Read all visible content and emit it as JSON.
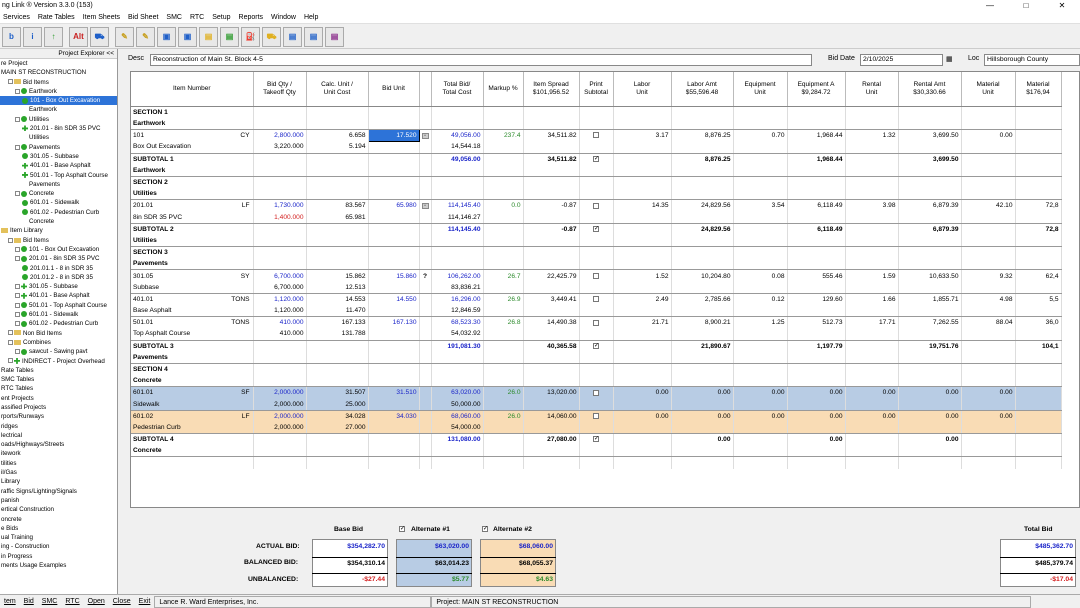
{
  "window": {
    "title": "ng Link ® Version  3.3.0 (153)",
    "controls": [
      "—",
      "□",
      "✕"
    ]
  },
  "menu": [
    "Services",
    "Rate Tables",
    "Item Sheets",
    "Bid Sheet",
    "SMC",
    "RTC",
    "Setup",
    "Reports",
    "Window",
    "Help"
  ],
  "toolbar": [
    "b",
    "i",
    "↑",
    "Alt",
    "⛟",
    "✎",
    "✎",
    "▣",
    "▣",
    "▤",
    "▤",
    "⛽",
    "⛟",
    "▤",
    "▤",
    "▤"
  ],
  "explorer": {
    "title": "Project Explorer <<",
    "tree": [
      {
        "t": "re Project",
        "d": 0,
        "i": ""
      },
      {
        "t": "MAIN ST RECONSTRUCTION",
        "d": 0,
        "i": ""
      },
      {
        "t": "Bid Items",
        "d": 1,
        "i": "f"
      },
      {
        "t": "Earthwork",
        "d": 2,
        "i": "g"
      },
      {
        "t": "101 - Box Out Excavation",
        "d": 3,
        "i": "g",
        "sel": true
      },
      {
        "t": "Earthwork",
        "d": 4,
        "i": ""
      },
      {
        "t": "Utilities",
        "d": 2,
        "i": "g"
      },
      {
        "t": "201.01 - 8in SDR 35 PVC",
        "d": 3,
        "i": "p"
      },
      {
        "t": "Utilities",
        "d": 4,
        "i": ""
      },
      {
        "t": "Pavements",
        "d": 2,
        "i": "g"
      },
      {
        "t": "301.05 - Subbase",
        "d": 3,
        "i": "g"
      },
      {
        "t": "401.01 - Base Asphalt",
        "d": 3,
        "i": "p"
      },
      {
        "t": "501.01 - Top Asphalt Course",
        "d": 3,
        "i": "p"
      },
      {
        "t": "Pavements",
        "d": 4,
        "i": ""
      },
      {
        "t": "Concrete",
        "d": 2,
        "i": "g"
      },
      {
        "t": "601.01 - Sidewalk",
        "d": 3,
        "i": "g"
      },
      {
        "t": "601.02 - Pedestrian Curb",
        "d": 3,
        "i": "g"
      },
      {
        "t": "Concrete",
        "d": 4,
        "i": ""
      },
      {
        "t": "Item Library",
        "d": 0,
        "i": "f"
      },
      {
        "t": "Bid Items",
        "d": 1,
        "i": "f"
      },
      {
        "t": "101 - Box Out Excavation",
        "d": 2,
        "i": "g"
      },
      {
        "t": "201.01 - 8in SDR 35 PVC",
        "d": 2,
        "i": "g"
      },
      {
        "t": "201.01.1 - 8 in SDR 35",
        "d": 3,
        "i": "g"
      },
      {
        "t": "201.01.2 - 8 in SDR 35",
        "d": 3,
        "i": "g"
      },
      {
        "t": "301.05 - Subbase",
        "d": 2,
        "i": "p"
      },
      {
        "t": "401.01 - Base Asphalt",
        "d": 2,
        "i": "p"
      },
      {
        "t": "501.01 - Top Asphalt Course",
        "d": 2,
        "i": "g"
      },
      {
        "t": "601.01 - Sidewalk",
        "d": 2,
        "i": "g"
      },
      {
        "t": "601.02 - Pedestrian Curb",
        "d": 2,
        "i": "g"
      },
      {
        "t": "Non Bid Items",
        "d": 1,
        "i": "f"
      },
      {
        "t": "Combines",
        "d": 1,
        "i": "f"
      },
      {
        "t": "sawcut - Sawing pavt",
        "d": 2,
        "i": "g"
      },
      {
        "t": "INDIRECT - Project Overhead",
        "d": 1,
        "i": "p"
      },
      {
        "t": "Rate Tables",
        "d": 0,
        "i": ""
      },
      {
        "t": "SMC Tables",
        "d": 0,
        "i": ""
      },
      {
        "t": "RTC Tables",
        "d": 0,
        "i": ""
      },
      {
        "t": "ent Projects",
        "d": 0,
        "i": ""
      },
      {
        "t": "assified Projects",
        "d": 0,
        "i": ""
      },
      {
        "t": "rports/Runways",
        "d": 0,
        "i": ""
      },
      {
        "t": "ridges",
        "d": 0,
        "i": ""
      },
      {
        "t": "lectrical",
        "d": 0,
        "i": ""
      },
      {
        "t": "oads/Highways/Streets",
        "d": 0,
        "i": ""
      },
      {
        "t": "itework",
        "d": 0,
        "i": ""
      },
      {
        "t": "tilities",
        "d": 0,
        "i": ""
      },
      {
        "t": "il/Gas",
        "d": 0,
        "i": ""
      },
      {
        "t": "Library",
        "d": 0,
        "i": ""
      },
      {
        "t": "raffic Signs/Lighting/Signals",
        "d": 0,
        "i": ""
      },
      {
        "t": "panish",
        "d": 0,
        "i": ""
      },
      {
        "t": "ertical Construction",
        "d": 0,
        "i": ""
      },
      {
        "t": "oncrete",
        "d": 0,
        "i": ""
      },
      {
        "t": "e Bids",
        "d": 0,
        "i": ""
      },
      {
        "t": "ual Training",
        "d": 0,
        "i": ""
      },
      {
        "t": "ing - Construction",
        "d": 0,
        "i": ""
      },
      {
        "t": "in Progress",
        "d": 0,
        "i": ""
      },
      {
        "t": "ments Usage Examples",
        "d": 0,
        "i": ""
      }
    ]
  },
  "header": {
    "desc_label": "Desc",
    "desc": "Reconstruction of Main St. Block 4-5",
    "date_label": "Bid Date",
    "date": "2/10/2025",
    "loc_label": "Loc",
    "loc": "Hillsborough County"
  },
  "columns": [
    {
      "l": "Item Number",
      "w": 122
    },
    {
      "l": "Bid Qty /\nTakeoff Qty",
      "w": 53
    },
    {
      "l": "Calc. Unit /\nUnit Cost",
      "w": 62
    },
    {
      "l": "Bid Unit",
      "w": 51
    },
    {
      "l": "",
      "w": 12
    },
    {
      "l": "Total Bid/\nTotal Cost",
      "w": 52
    },
    {
      "l": "Markup %",
      "w": 40
    },
    {
      "l": "Item Spread\n$101,956.52",
      "w": 56
    },
    {
      "l": "Print\nSubtotal",
      "w": 34
    },
    {
      "l": "Labor\nUnit",
      "w": 58
    },
    {
      "l": "Labor Amt\n$55,596.48",
      "w": 62
    },
    {
      "l": "Equipment\nUnit",
      "w": 54
    },
    {
      "l": "Equipment A\n$9,284.72",
      "w": 58
    },
    {
      "l": "Rental\nUnit",
      "w": 53
    },
    {
      "l": "Rental Amt\n$30,330.66",
      "w": 63
    },
    {
      "l": "Material\nUnit",
      "w": 54
    },
    {
      "l": "Material\n$176,94",
      "w": 46
    }
  ],
  "rows": [
    {
      "k": "sec",
      "a": "SECTION 1"
    },
    {
      "k": "sec2",
      "a": "Earthwork"
    },
    {
      "k": "i1",
      "cls": "",
      "arrow": true,
      "a": "101",
      "u": "CY",
      "q": "2,800.000",
      "cu": "6.658",
      "bu": "17.520",
      "tb": "49,056.00",
      "mk": "237.4",
      "sp": "34,511.82",
      "ps": false,
      "lu": "3.17",
      "la": "8,876.25",
      "eu": "0.70",
      "ea": "1,968.44",
      "ru": "1.32",
      "ra": "3,699.50",
      "mu": "0.00",
      "ma": ""
    },
    {
      "k": "i2",
      "cls": "",
      "a": "Box Out Excavation",
      "q": "3,220.000",
      "cu": "5.194",
      "tb": "14,544.18"
    },
    {
      "k": "sub",
      "a": "SUBTOTAL 1",
      "tb": "49,056.00",
      "sp": "34,511.82",
      "ps": true,
      "la": "8,876.25",
      "ea": "1,968.44",
      "ra": "3,699.50"
    },
    {
      "k": "sub2",
      "a": "Earthwork"
    },
    {
      "k": "sec",
      "a": "SECTION 2"
    },
    {
      "k": "sec2",
      "a": "Utilities"
    },
    {
      "k": "i1",
      "cls": "",
      "a": "201.01",
      "u": "LF",
      "q": "1,730.000",
      "cu": "83.567",
      "bu": "65.980",
      "tb": "114,145.40",
      "mk": "0.0",
      "sp": "-0.87",
      "ps": false,
      "lu": "14.35",
      "la": "24,829.56",
      "eu": "3.54",
      "ea": "6,118.49",
      "ru": "3.98",
      "ra": "6,879.39",
      "mu": "42.10",
      "ma": "72,8"
    },
    {
      "k": "i2",
      "cls": "",
      "a": "8in SDR 35 PVC",
      "q": "1,400.000",
      "qred": true,
      "cu": "65.981",
      "tb": "114,146.27"
    },
    {
      "k": "sub",
      "a": "SUBTOTAL 2",
      "tb": "114,145.40",
      "sp": "-0.87",
      "ps": true,
      "la": "24,829.56",
      "ea": "6,118.49",
      "ra": "6,879.39",
      "ma": "72,8"
    },
    {
      "k": "sub2",
      "a": "Utilities"
    },
    {
      "k": "sec",
      "a": "SECTION 3"
    },
    {
      "k": "sec2",
      "a": "Pavements"
    },
    {
      "k": "i1",
      "cls": "",
      "a": "301.05",
      "u": "SY",
      "q": "6,700.000",
      "cu": "15.862",
      "bu": "15.860",
      "q2": true,
      "tb": "106,262.00",
      "mk": "26.7",
      "sp": "22,425.79",
      "ps": false,
      "lu": "1.52",
      "la": "10,204.80",
      "eu": "0.08",
      "ea": "555.46",
      "ru": "1.59",
      "ra": "10,633.50",
      "mu": "9.32",
      "ma": "62,4"
    },
    {
      "k": "i2",
      "cls": "",
      "a": "Subbase",
      "q": "6,700.000",
      "cu": "12.513",
      "tb": "83,836.21"
    },
    {
      "k": "i1",
      "cls": "",
      "a": "401.01",
      "u": "TONS",
      "q": "1,120.000",
      "cu": "14.553",
      "bu": "14.550",
      "tb": "16,296.00",
      "mk": "26.9",
      "sp": "3,449.41",
      "ps": false,
      "lu": "2.49",
      "la": "2,785.66",
      "eu": "0.12",
      "ea": "129.60",
      "ru": "1.66",
      "ra": "1,855.71",
      "mu": "4.98",
      "ma": "5,5"
    },
    {
      "k": "i2",
      "cls": "",
      "a": "Base Asphalt",
      "q": "1,120.000",
      "cu": "11.470",
      "tb": "12,846.59"
    },
    {
      "k": "i1",
      "cls": "",
      "a": "501.01",
      "u": "TONS",
      "q": "410.000",
      "cu": "167.133",
      "bu": "167.130",
      "tb": "68,523.30",
      "mk": "26.8",
      "sp": "14,490.38",
      "ps": false,
      "lu": "21.71",
      "la": "8,900.21",
      "eu": "1.25",
      "ea": "512.73",
      "ru": "17.71",
      "ra": "7,262.55",
      "mu": "88.04",
      "ma": "36,0"
    },
    {
      "k": "i2",
      "cls": "",
      "a": "Top Asphalt Course",
      "q": "410.000",
      "cu": "131.788",
      "tb": "54,032.92"
    },
    {
      "k": "sub",
      "a": "SUBTOTAL 3",
      "tb": "191,081.30",
      "sp": "40,365.58",
      "ps": true,
      "la": "21,890.67",
      "ea": "1,197.79",
      "ra": "19,751.76",
      "ma": "104,1"
    },
    {
      "k": "sub2",
      "a": "Pavements"
    },
    {
      "k": "sec",
      "a": "SECTION 4"
    },
    {
      "k": "sec2",
      "a": "Concrete"
    },
    {
      "k": "i1",
      "cls": "blueRow",
      "a": "601.01",
      "u": "SF",
      "q": "2,000.000",
      "cu": "31.507",
      "bu": "31.510",
      "tb": "63,020.00",
      "mk": "26.0",
      "sp": "13,020.00",
      "ps": false,
      "lu": "0.00",
      "la": "0.00",
      "eu": "0.00",
      "ea": "0.00",
      "ru": "0.00",
      "ra": "0.00",
      "mu": "0.00",
      "ma": ""
    },
    {
      "k": "i2",
      "cls": "blueRow",
      "a": "Sidewalk",
      "q": "2,000.000",
      "cu": "25.000",
      "tb": "50,000.00"
    },
    {
      "k": "i1",
      "cls": "orgRow",
      "a": "601.02",
      "u": "LF",
      "q": "2,000.000",
      "cu": "34.028",
      "bu": "34.030",
      "tb": "68,060.00",
      "mk": "26.0",
      "sp": "14,060.00",
      "ps": false,
      "lu": "0.00",
      "la": "0.00",
      "eu": "0.00",
      "ea": "0.00",
      "ru": "0.00",
      "ra": "0.00",
      "mu": "0.00",
      "ma": ""
    },
    {
      "k": "i2",
      "cls": "orgRow",
      "a": "Pedestrian Curb",
      "q": "2,000.000",
      "cu": "27.000",
      "tb": "54,000.00"
    },
    {
      "k": "sub",
      "a": "SUBTOTAL 4",
      "tb": "131,080.00",
      "sp": "27,080.00",
      "ps": true,
      "la": "0.00",
      "ea": "0.00",
      "ra": "0.00",
      "ma": ""
    },
    {
      "k": "sub2",
      "a": "Concrete"
    }
  ],
  "summary": {
    "base_bid": "Base Bid",
    "alt1": "Alternate #1",
    "alt2": "Alternate #2",
    "total": "Total Bid",
    "actual_label": "ACTUAL BID:",
    "balanced_label": "BALANCED BID:",
    "unbalanced_label": "UNBALANCED:",
    "base": [
      "$354,282.70",
      "$354,310.14",
      "-$27.44"
    ],
    "a1": [
      "$63,020.00",
      "$63,014.23",
      "$5.77"
    ],
    "a2": [
      "$68,060.00",
      "$68,055.37",
      "$4.63"
    ],
    "tot": [
      "$485,362.70",
      "$485,379.74",
      "-$17.04"
    ]
  },
  "status": {
    "buttons": [
      "tem",
      "Bid",
      "SMC",
      "RTC",
      "Open",
      "Close",
      "Exit"
    ],
    "company": "Lance R. Ward Enterprises, Inc.",
    "project": "Project: MAIN ST RECONSTRUCTION"
  }
}
